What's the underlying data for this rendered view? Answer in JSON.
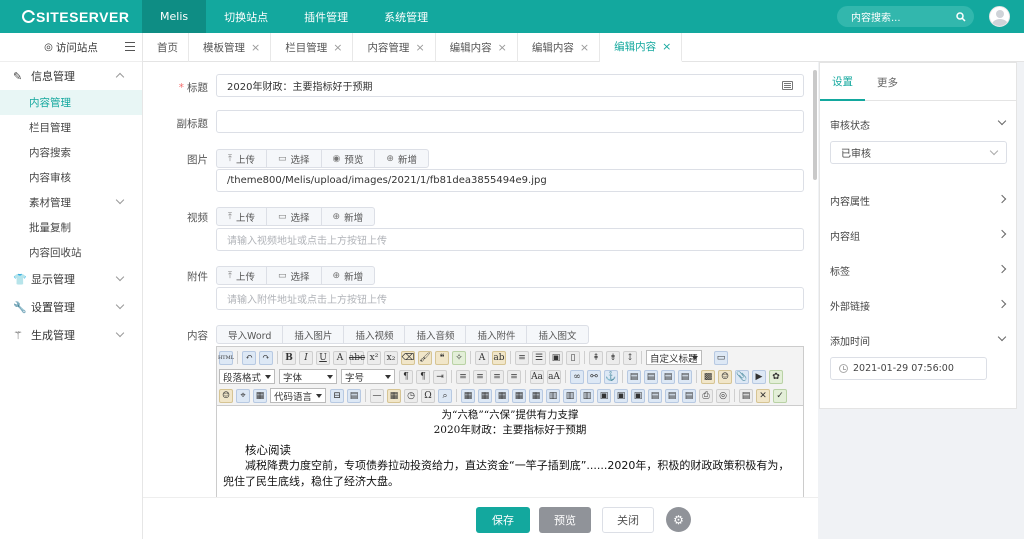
{
  "topbar": {
    "logo": "SITESERVER",
    "nav": [
      "Melis",
      "切换站点",
      "插件管理",
      "系统管理"
    ],
    "search_placeholder": "内容搜索..."
  },
  "sidebar": {
    "visit_site": "访问站点",
    "groups": [
      {
        "label": "信息管理",
        "icon": "edit-icon",
        "children": [
          "内容管理",
          "栏目管理",
          "内容搜索",
          "内容审核",
          "素材管理",
          "批量复制",
          "内容回收站"
        ]
      },
      {
        "label": "显示管理",
        "icon": "shirt-icon"
      },
      {
        "label": "设置管理",
        "icon": "wrench-icon"
      },
      {
        "label": "生成管理",
        "icon": "magic-wand-icon"
      }
    ]
  },
  "tabs": [
    {
      "label": "首页",
      "closable": false
    },
    {
      "label": "模板管理",
      "closable": true
    },
    {
      "label": "栏目管理",
      "closable": true
    },
    {
      "label": "内容管理",
      "closable": true
    },
    {
      "label": "编辑内容",
      "closable": true
    },
    {
      "label": "编辑内容",
      "closable": true
    },
    {
      "label": "编辑内容",
      "closable": true,
      "active": true
    }
  ],
  "form": {
    "title_label": "标题",
    "title_value": "2020年财政：主要指标好于预期",
    "subtitle_label": "副标题",
    "subtitle_value": "",
    "image_label": "图片",
    "image_buttons": [
      "上传",
      "选择",
      "预览",
      "新增"
    ],
    "image_value": "/theme800/Melis/upload/images/2021/1/fb81dea3855494e9.jpg",
    "video_label": "视频",
    "video_buttons": [
      "上传",
      "选择",
      "新增"
    ],
    "video_placeholder": "请输入视频地址或点击上方按钮上传",
    "attach_label": "附件",
    "attach_buttons": [
      "上传",
      "选择",
      "新增"
    ],
    "attach_placeholder": "请输入附件地址或点击上方按钮上传",
    "content_label": "内容",
    "content_buttons": [
      "导入Word",
      "插入图片",
      "插入视频",
      "插入音频",
      "插入附件",
      "插入图文"
    ]
  },
  "editor": {
    "dropdowns": {
      "custom_title": "自定义标题",
      "paragraph": "段落格式",
      "font": "字体",
      "size": "字号",
      "code": "代码语言"
    },
    "line1": "为“六稳”“六保”提供有力支撑",
    "line2": "2020年财政：主要指标好于预期",
    "heading": "核心阅读",
    "para": "减税降费力度空前，专项债券拉动投资给力，直达资金“一竿子插到底”......2020年，积极的财政政策积极有为，兜住了民生底线，稳住了经济大盘。"
  },
  "rpanel": {
    "tabs": [
      "设置",
      "更多"
    ],
    "audit_label": "审核状态",
    "audit_value": "已审核",
    "items": [
      "内容属性",
      "内容组",
      "标签",
      "外部链接"
    ],
    "add_time_label": "添加时间",
    "add_time_value": "2021-01-29 07:56:00"
  },
  "actions": {
    "save": "保存",
    "preview": "预览",
    "close": "关闭"
  }
}
